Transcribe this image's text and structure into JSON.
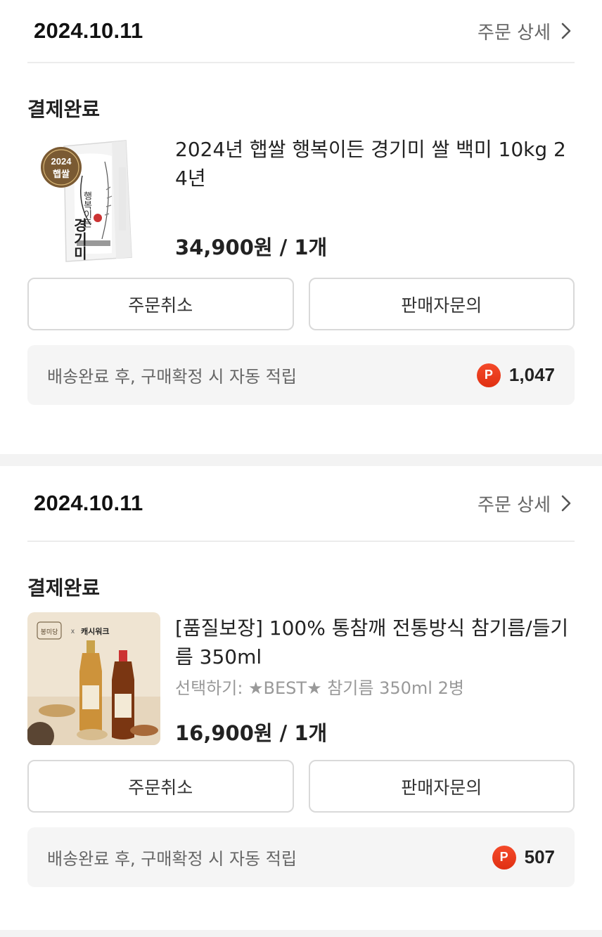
{
  "orders": [
    {
      "date": "2024.10.11",
      "detail_label": "주문 상세",
      "status": "결제완료",
      "product_name": "2024년 햅쌀 행복이든 경기미 쌀 백미 10kg 24년",
      "option": "",
      "price": "34,900원 / 1개",
      "thumb": {
        "badge_year": "2024",
        "badge_text": "햅쌀",
        "brand": "경기미",
        "sub": "행복이든"
      },
      "buttons": {
        "cancel": "주문취소",
        "inquiry": "판매자문의"
      },
      "point_text": "배송완료 후, 구매확정 시 자동 적립",
      "point_badge": "P",
      "point_amount": "1,047"
    },
    {
      "date": "2024.10.11",
      "detail_label": "주문 상세",
      "status": "결제완료",
      "product_name": "[품질보장] 100% 통참깨 전통방식 참기름/들기름 350ml",
      "option": "선택하기: ★BEST★ 참기름 350ml 2병",
      "price": "16,900원 / 1개",
      "thumb": {
        "brand": "봉미당",
        "x": "x",
        "partner": "캐시워크"
      },
      "buttons": {
        "cancel": "주문취소",
        "inquiry": "판매자문의"
      },
      "point_text": "배송완료 후, 구매확정 시 자동 적립",
      "point_badge": "P",
      "point_amount": "507"
    }
  ],
  "colors": {
    "point_badge": "#ea3a1b",
    "divider": "#ececec",
    "background": "#f3f3f3"
  },
  "icons": {
    "detail": "chevron-right-icon",
    "point": "point-p-icon"
  }
}
